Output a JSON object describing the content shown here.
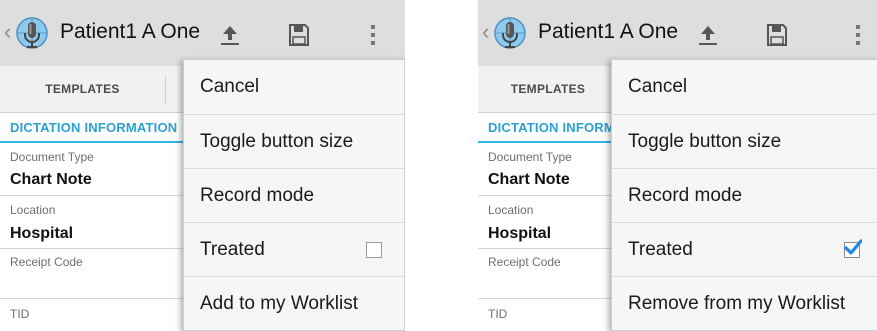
{
  "screens": [
    {
      "title": "Patient1 A One",
      "tab_templates": "TEMPLATES",
      "section_header": "DICTATION INFORMATION",
      "fields": [
        {
          "label": "Document Type",
          "value": "Chart Note"
        },
        {
          "label": "Location",
          "value": "Hospital"
        },
        {
          "label": "Receipt Code",
          "value": ""
        },
        {
          "label": "TID",
          "value": ""
        }
      ],
      "menu": {
        "items": [
          "Cancel",
          "Toggle button size",
          "Record mode",
          "Treated",
          "Add to my Worklist"
        ],
        "treated_checked": false
      }
    },
    {
      "title": "Patient1 A One",
      "tab_templates": "TEMPLATES",
      "section_header": "DICTATION INFORMATION",
      "fields": [
        {
          "label": "Document Type",
          "value": "Chart Note"
        },
        {
          "label": "Location",
          "value": "Hospital"
        },
        {
          "label": "Receipt Code",
          "value": ""
        },
        {
          "label": "TID",
          "value": ""
        }
      ],
      "menu": {
        "items": [
          "Cancel",
          "Toggle button size",
          "Record mode",
          "Treated",
          "Remove from my Worklist"
        ],
        "treated_checked": true
      }
    }
  ],
  "icons": {
    "back": "chevron-left-icon",
    "app": "microphone-app-icon",
    "upload": "upload-icon",
    "save": "save-icon",
    "overflow": "overflow-menu-icon",
    "checkbox": "checkbox-icon"
  },
  "colors": {
    "actionbar": "#dedede",
    "accent": "#33b5e5",
    "check": "#1e88e5"
  }
}
